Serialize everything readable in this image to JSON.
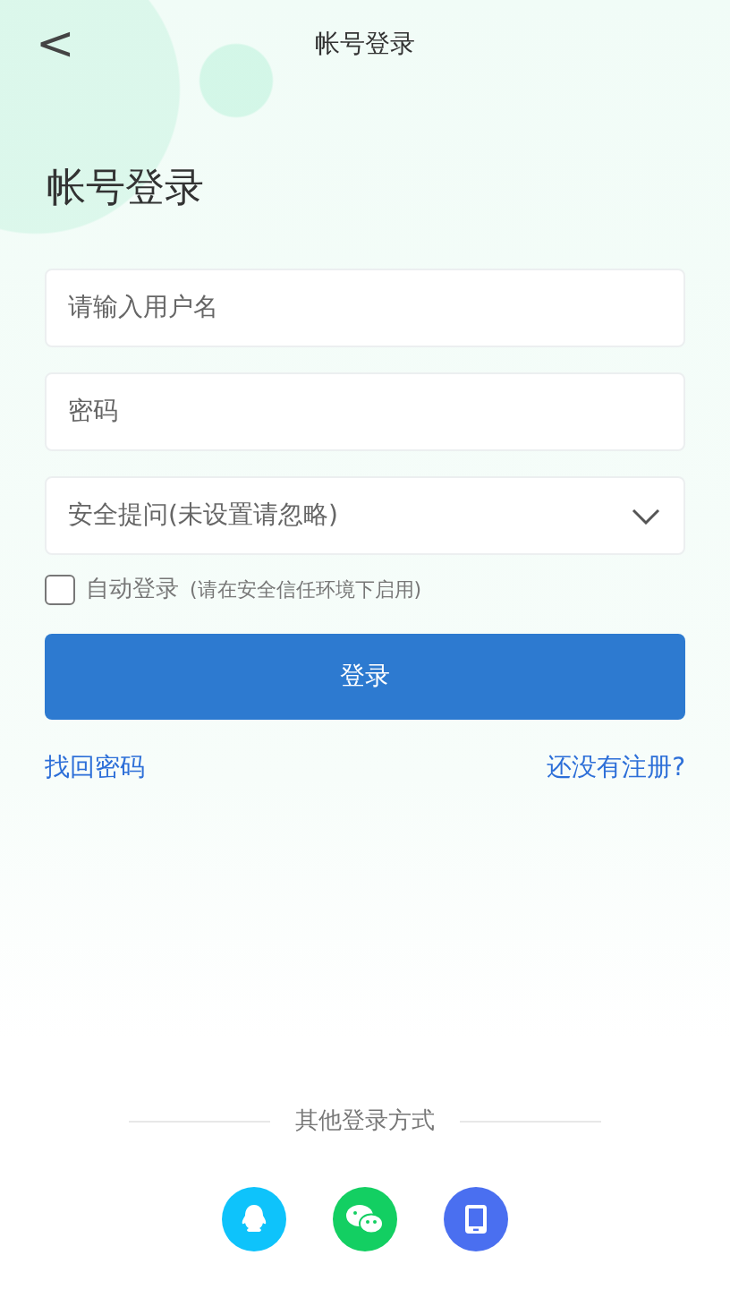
{
  "header": {
    "back": "<",
    "title": "帐号登录"
  },
  "heading": "帐号登录",
  "fields": [
    {
      "kind": "text",
      "placeholder": "请输入用户名"
    },
    {
      "kind": "password",
      "placeholder": "密码"
    },
    {
      "kind": "select",
      "placeholder": "安全提问(未设置请忽略)"
    }
  ],
  "auto_login": {
    "label": "自动登录",
    "hint": "(请在安全信任环境下启用)",
    "checked": false
  },
  "login_button": "登录",
  "links": {
    "forgot": "找回密码",
    "register": "还没有注册?"
  },
  "other": {
    "title": "其他登录方式",
    "options": [
      {
        "kind": "penguin",
        "color": "#0ec3fb"
      },
      {
        "kind": "chat",
        "color": "#13cf62"
      },
      {
        "kind": "tablet",
        "color": "#4a6ff0"
      }
    ]
  }
}
